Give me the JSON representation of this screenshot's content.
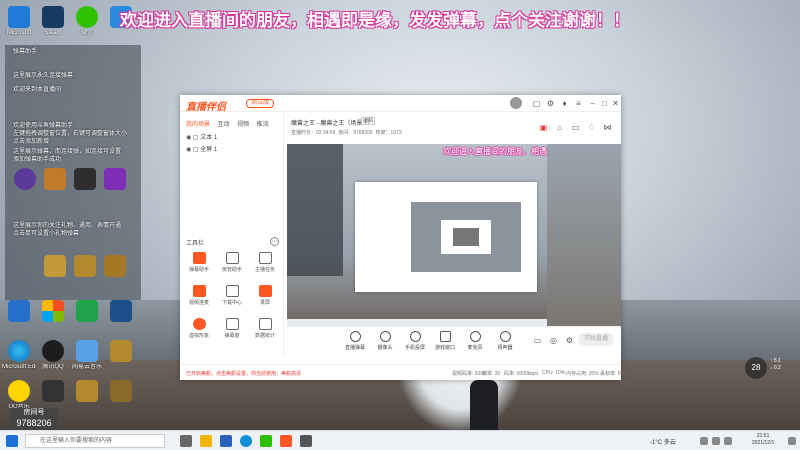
{
  "banner": "欢迎进入直播间的朋友，相遇即是缘，发发弹幕，点个关注谢谢！！",
  "desktop_icons": [
    "Microsoft",
    "Steam",
    "微信",
    "",
    "",
    "",
    "",
    "Microsoft Edge",
    "腾讯QQ",
    "网易云音乐",
    "",
    "QQ音乐",
    "",
    "",
    ""
  ],
  "left_panel": {
    "title": "弹幕助手",
    "lines": [
      "这里展示永久连接弹幕",
      "欢迎来到本直播间",
      "欢迎使用斗鱼弹幕助手",
      "左键拖拽调整窗位置，右键可调整窗体大小",
      "点击添加新增",
      "这里展示弹幕，而连接弹，如连接可设置",
      "添加弹幕助手成功",
      "这里展示你的关注礼物、通用、表情开通",
      "点击单可设置小礼物弹幕"
    ]
  },
  "room": {
    "label": "房间号",
    "number": "9788206"
  },
  "weather_widget": {
    "temp": "28",
    "lines": [
      "↑ 5.1",
      "↓ 0.2"
    ]
  },
  "app": {
    "logo": "直播伴侣",
    "pill": "测试版",
    "tabs": [
      "我的场景",
      "互动",
      "视频",
      "推流"
    ],
    "scenes": [
      "文本 1",
      "全屏 1"
    ],
    "tool_header": "工具栏",
    "tools": [
      {
        "label": "弹幕助手",
        "color": "#ff5722"
      },
      {
        "label": "房管助手",
        "color": "#666"
      },
      {
        "label": "主播任务",
        "color": "#666"
      },
      {
        "label": "视频连麦",
        "color": "#ff5722"
      },
      {
        "label": "下载中心",
        "color": "#666"
      },
      {
        "label": "录屏",
        "color": "#ff5722"
      },
      {
        "label": "虚拟形象",
        "color": "#ff5722"
      },
      {
        "label": "弹幕窗",
        "color": "#666"
      },
      {
        "label": "数据统计",
        "color": "#666"
      }
    ],
    "room_title": "魔兽之王 - 魔兽之王（场景 1）",
    "room_edit": "编辑",
    "room_sub": [
      "直播时长：03:34:59",
      "房间：9788206",
      "热度：1973"
    ],
    "preview_banner": "欢迎进入直播间的朋友，相遇即是缘，发发弹幕，点个关注谢谢！！",
    "controls": [
      {
        "label": "直播弹幕"
      },
      {
        "label": "摄像头"
      },
      {
        "label": "手机投屏"
      },
      {
        "label": "游戏窗口"
      },
      {
        "label": "麦克风"
      },
      {
        "label": "扬声器"
      }
    ],
    "start_label": "开始直播",
    "status": [
      "已开启美颜，点击美颜设置，你当前使用：美颜高清",
      "视频码率: 5000",
      "帧率: 30",
      "码率: 5000kbps",
      "CPU: 10%",
      "内存占用: 20%",
      "丢帧率: 0%"
    ]
  },
  "taskbar": {
    "search_placeholder": "在这里输入你要搜索的内容",
    "weather": "-1°C 多云",
    "time": "21:51",
    "date": "2021/12/1"
  }
}
